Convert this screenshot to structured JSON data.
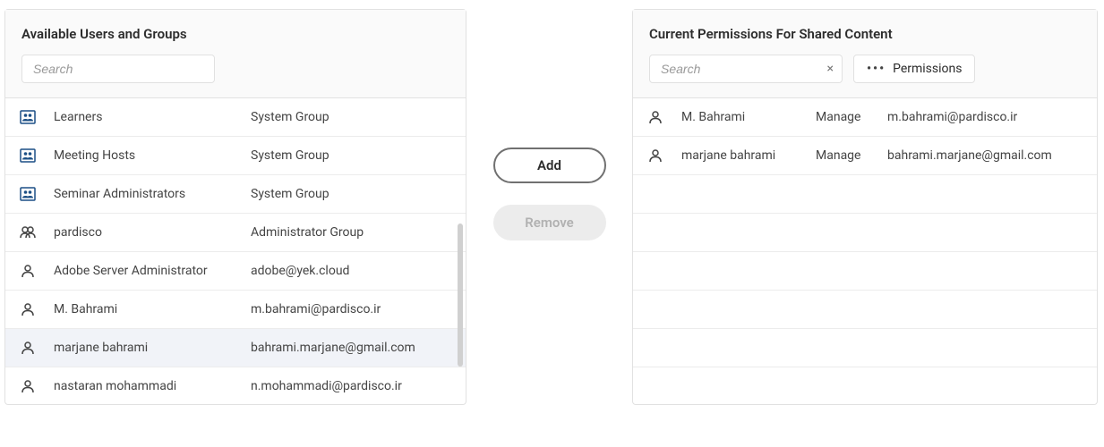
{
  "leftPanel": {
    "title": "Available Users and Groups",
    "searchPlaceholder": "Search",
    "rows": [
      {
        "iconType": "group",
        "name": "Learners",
        "detail": "System Group",
        "selected": false
      },
      {
        "iconType": "group",
        "name": "Meeting Hosts",
        "detail": "System Group",
        "selected": false
      },
      {
        "iconType": "group",
        "name": "Seminar Administrators",
        "detail": "System Group",
        "selected": false
      },
      {
        "iconType": "usergroup",
        "name": "pardisco",
        "detail": "Administrator Group",
        "selected": false
      },
      {
        "iconType": "user",
        "name": "Adobe Server Administrator",
        "detail": "adobe@yek.cloud",
        "selected": false
      },
      {
        "iconType": "user",
        "name": "M. Bahrami",
        "detail": "m.bahrami@pardisco.ir",
        "selected": false
      },
      {
        "iconType": "user",
        "name": "marjane bahrami",
        "detail": "bahrami.marjane@gmail.com",
        "selected": true
      },
      {
        "iconType": "user",
        "name": "nastaran mohammadi",
        "detail": "n.mohammadi@pardisco.ir",
        "selected": false
      }
    ]
  },
  "middle": {
    "addLabel": "Add",
    "removeLabel": "Remove"
  },
  "rightPanel": {
    "title": "Current Permissions For Shared Content",
    "searchPlaceholder": "Search",
    "permissionsButton": "Permissions",
    "rows": [
      {
        "iconType": "user",
        "name": "M. Bahrami",
        "permission": "Manage",
        "email": "m.bahrami@pardisco.ir"
      },
      {
        "iconType": "user",
        "name": "marjane bahrami",
        "permission": "Manage",
        "email": "bahrami.marjane@gmail.com"
      }
    ],
    "emptyRows": 5
  }
}
